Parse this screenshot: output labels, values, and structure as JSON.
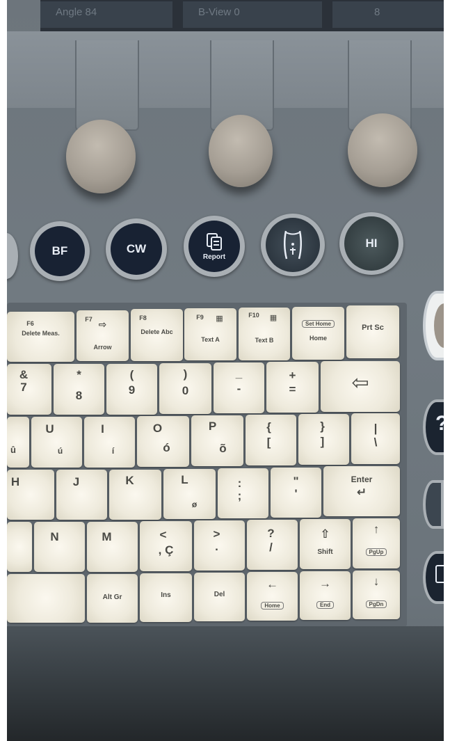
{
  "screen": {
    "cells": [
      "Angle  84",
      "B-View  0",
      "8"
    ]
  },
  "buttons": [
    {
      "label": "BF"
    },
    {
      "label": "CW"
    },
    {
      "label": "Report",
      "icon": "report-icon"
    },
    {
      "label": "",
      "icon": "body-mark-icon"
    },
    {
      "label": "HI"
    }
  ],
  "function_keys": [
    {
      "fn": "F6",
      "label": "Delete Meas."
    },
    {
      "fn": "F7",
      "label": "Arrow"
    },
    {
      "fn": "F8",
      "label": "Delete Abc"
    },
    {
      "fn": "F9",
      "label": "Text A"
    },
    {
      "fn": "F10",
      "label": "Text B"
    },
    {
      "fn": "Set Home",
      "label": "Home"
    },
    {
      "fn": "",
      "label": "Prt Sc"
    }
  ],
  "number_row": [
    {
      "top": "&",
      "bottom": "7"
    },
    {
      "top": "*",
      "bottom": "8"
    },
    {
      "top": "(",
      "bottom": "9"
    },
    {
      "top": ")",
      "bottom": "0"
    },
    {
      "top": "_",
      "bottom": "-"
    },
    {
      "top": "+",
      "bottom": "="
    },
    {
      "top": "⇦",
      "bottom": ""
    }
  ],
  "upper_row": [
    {
      "top": "",
      "bottom": "û"
    },
    {
      "top": "U",
      "bottom": "ú"
    },
    {
      "top": "I",
      "bottom": "í"
    },
    {
      "top": "O",
      "bottom": "ó"
    },
    {
      "top": "P",
      "bottom": "õ"
    },
    {
      "top": "{",
      "bottom": "["
    },
    {
      "top": "}",
      "bottom": "]"
    },
    {
      "top": "|",
      "bottom": "\\"
    }
  ],
  "home_row": [
    {
      "top": "H",
      "bottom": ""
    },
    {
      "top": "J",
      "bottom": ""
    },
    {
      "top": "K",
      "bottom": ""
    },
    {
      "top": "L",
      "bottom": "ø"
    },
    {
      "top": ":",
      "bottom": ";"
    },
    {
      "top": "\"",
      "bottom": "'"
    },
    {
      "top": "Enter",
      "bottom": "↵"
    }
  ],
  "lower_row": [
    {
      "top": "",
      "bottom": ""
    },
    {
      "top": "N",
      "bottom": ""
    },
    {
      "top": "M",
      "bottom": ""
    },
    {
      "top": "<",
      "bottom": ", Ç"
    },
    {
      "top": ">",
      "bottom": "."
    },
    {
      "top": "?",
      "bottom": "/"
    },
    {
      "top": "⇧",
      "bottom": "Shift"
    },
    {
      "top": "↑",
      "bottom": "PgUp"
    }
  ],
  "bottom_row": [
    {
      "top": "",
      "bottom": ""
    },
    {
      "top": "Alt Gr",
      "bottom": ""
    },
    {
      "top": "Ins",
      "bottom": ""
    },
    {
      "top": "Del",
      "bottom": ""
    },
    {
      "top": "←",
      "bottom": "Home"
    },
    {
      "top": "→",
      "bottom": "End"
    },
    {
      "top": "↓",
      "bottom": "PgDn"
    }
  ]
}
